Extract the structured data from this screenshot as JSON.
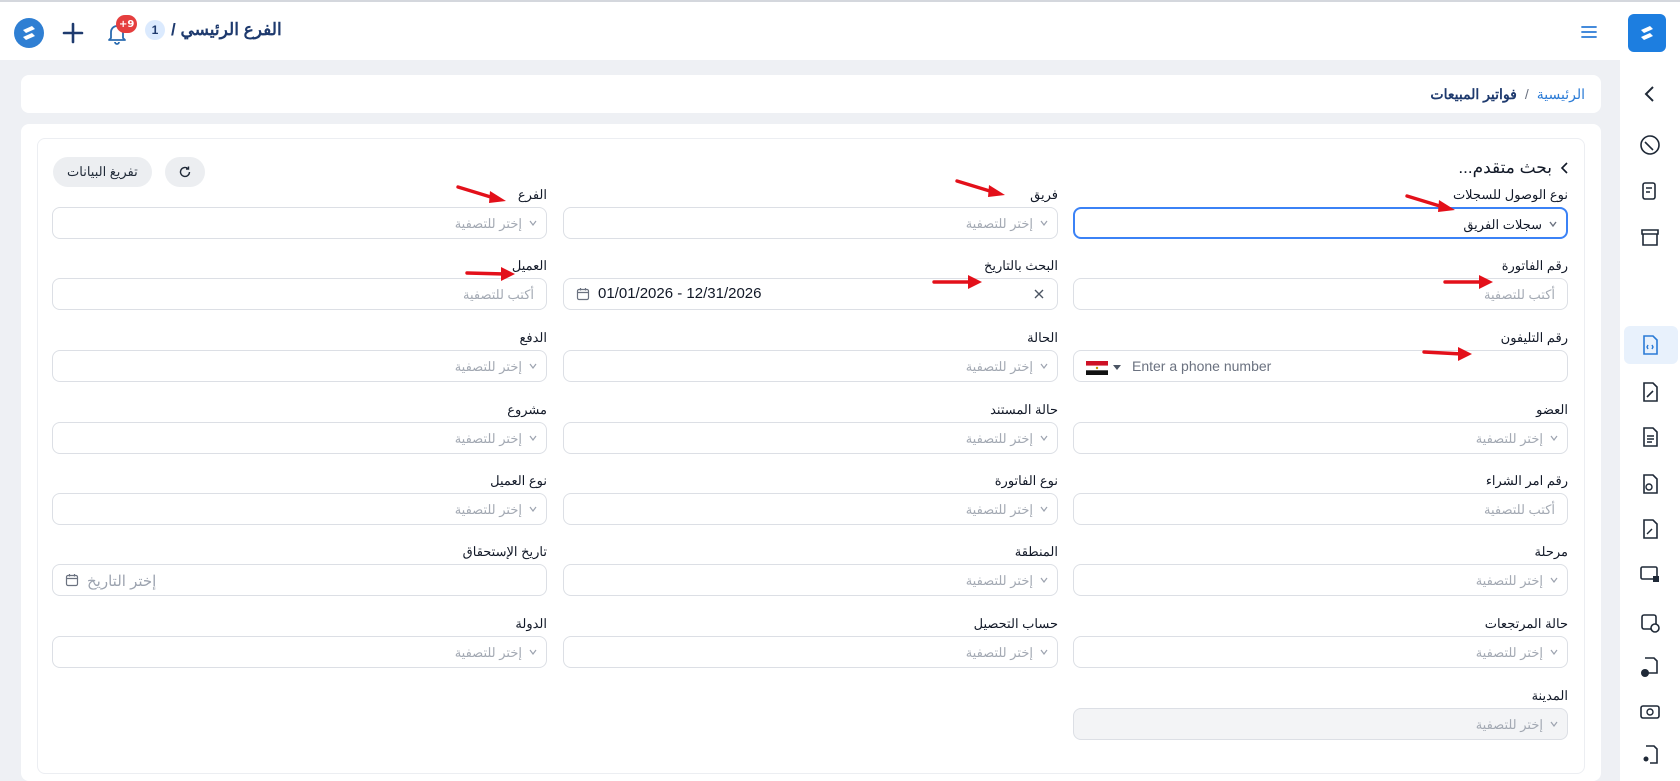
{
  "topbar": {
    "branch_name": "الفرع الرئيسي /",
    "branch_count": "1",
    "notification_badge": "+9"
  },
  "breadcrumb": {
    "home": "الرئيسية",
    "separator": "/",
    "current": "فواتير المبيعات"
  },
  "search": {
    "title": "بحث متقدم...",
    "clear_button": "تفريغ البيانات"
  },
  "fields": {
    "record_access_type": {
      "label": "نوع الوصول للسجلات",
      "value": "سجلات الفريق"
    },
    "team": {
      "label": "فريق",
      "placeholder": "إختر للتصفية"
    },
    "branch": {
      "label": "الفرع",
      "placeholder": "إختر للتصفية"
    },
    "invoice_number": {
      "label": "رقم الفاتورة",
      "placeholder": "أكتب للتصفية"
    },
    "date_search": {
      "label": "البحث بالتاريخ",
      "value": "01/01/2026 - 12/31/2026"
    },
    "customer": {
      "label": "العميل",
      "placeholder": "أكتب للتصفية"
    },
    "phone": {
      "label": "رقم التليفون",
      "placeholder": "Enter a phone number"
    },
    "status": {
      "label": "الحالة",
      "placeholder": "إختر للتصفية"
    },
    "payment": {
      "label": "الدفع",
      "placeholder": "إختر للتصفية"
    },
    "member": {
      "label": "العضو",
      "placeholder": "إختر للتصفية"
    },
    "document_status": {
      "label": "حالة المستند",
      "placeholder": "إختر للتصفية"
    },
    "project": {
      "label": "مشروع",
      "placeholder": "إختر للتصفية"
    },
    "po_number": {
      "label": "رقم امر الشراء",
      "placeholder": "أكتب للتصفية"
    },
    "invoice_type": {
      "label": "نوع الفاتورة",
      "placeholder": "إختر للتصفية"
    },
    "customer_type": {
      "label": "نوع العميل",
      "placeholder": "إختر للتصفية"
    },
    "stage": {
      "label": "مرحلة",
      "placeholder": "إختر للتصفية"
    },
    "region": {
      "label": "المنطقة",
      "placeholder": "إختر للتصفية"
    },
    "due_date": {
      "label": "تاريخ الإستحقاق",
      "placeholder": "إختر التاريخ"
    },
    "returns_status": {
      "label": "حالة المرتجعات",
      "placeholder": "إختر للتصفية"
    },
    "collection_account": {
      "label": "حساب التحصيل",
      "placeholder": "إختر للتصفية"
    },
    "country": {
      "label": "الدولة",
      "placeholder": "إختر للتصفية"
    },
    "city": {
      "label": "المدينة",
      "placeholder": "إختر للتصفية"
    }
  },
  "colors": {
    "accent": "#1d7ee0",
    "annotation_arrow": "#e3101a",
    "badge": "#e53e3e"
  }
}
